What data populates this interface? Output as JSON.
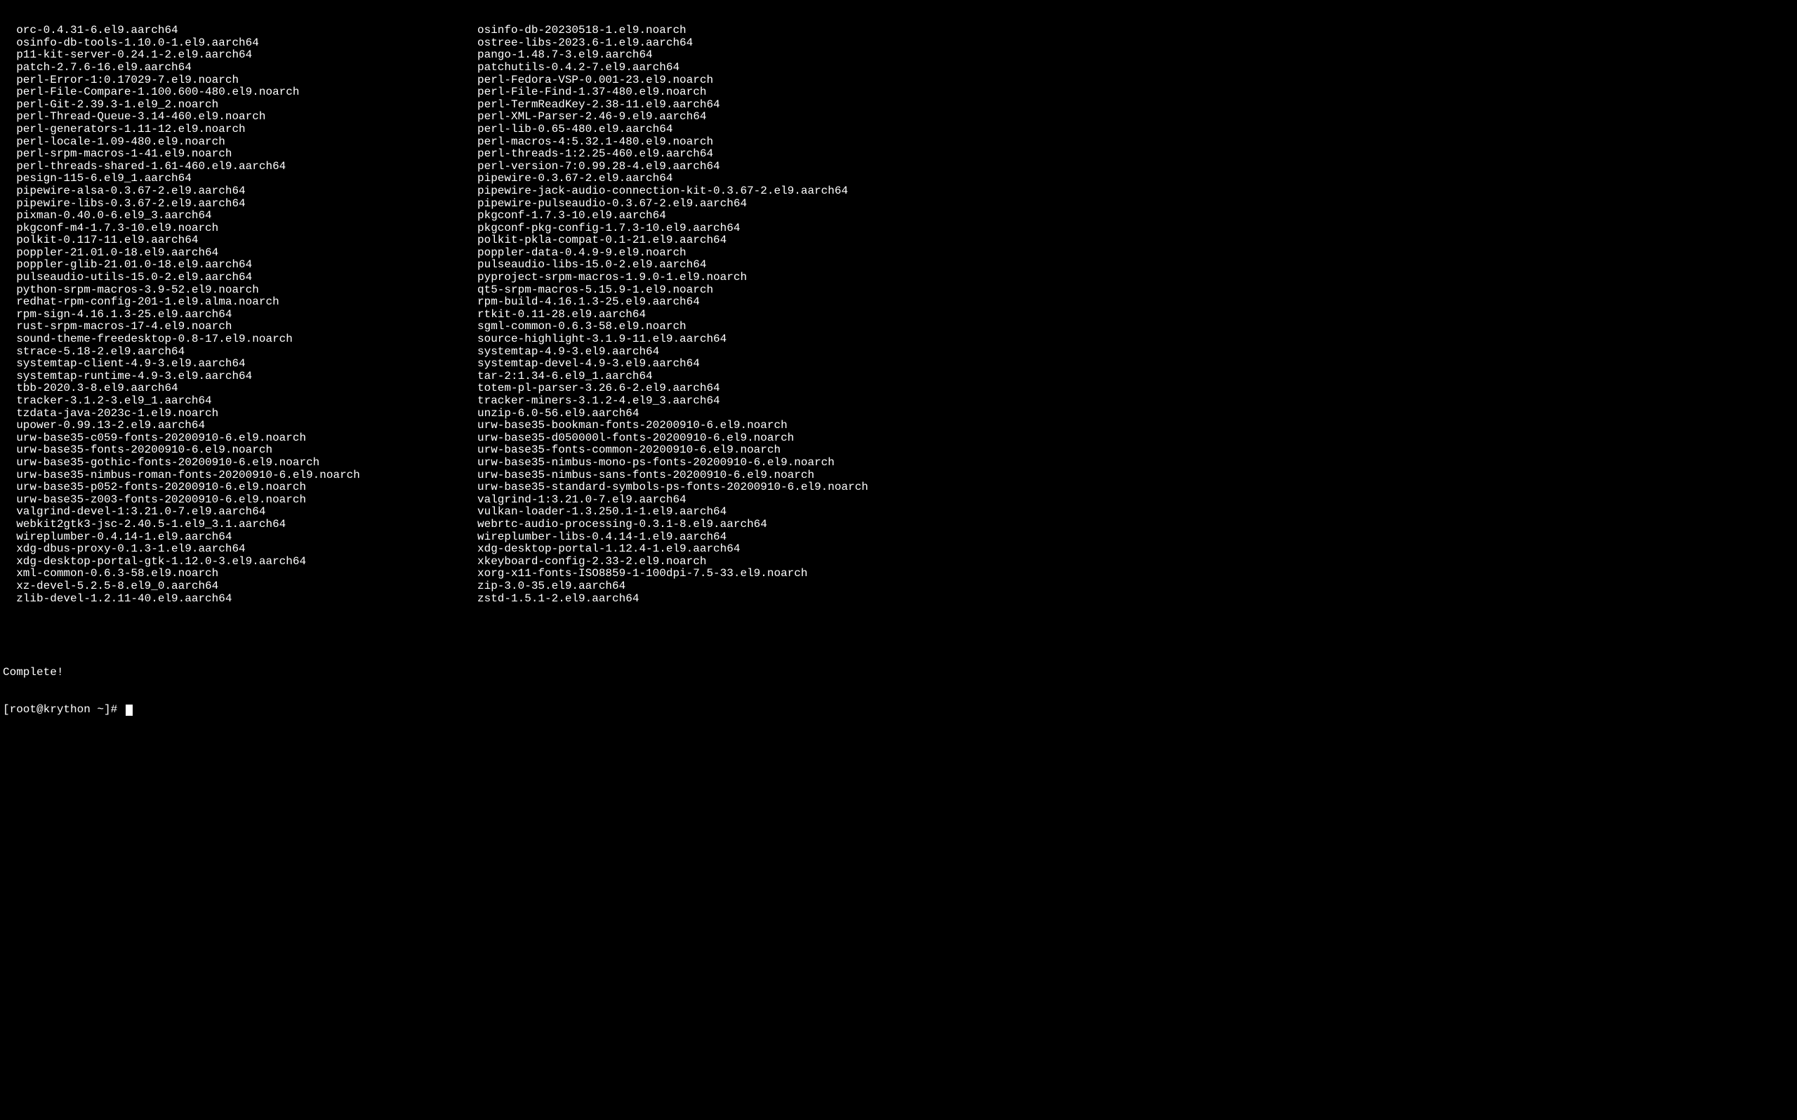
{
  "terminal": {
    "packages_left": [
      "  orc-0.4.31-6.el9.aarch64",
      "  osinfo-db-tools-1.10.0-1.el9.aarch64",
      "  p11-kit-server-0.24.1-2.el9.aarch64",
      "  patch-2.7.6-16.el9.aarch64",
      "  perl-Error-1:0.17029-7.el9.noarch",
      "  perl-File-Compare-1.100.600-480.el9.noarch",
      "  perl-Git-2.39.3-1.el9_2.noarch",
      "  perl-Thread-Queue-3.14-460.el9.noarch",
      "  perl-generators-1.11-12.el9.noarch",
      "  perl-locale-1.09-480.el9.noarch",
      "  perl-srpm-macros-1-41.el9.noarch",
      "  perl-threads-shared-1.61-460.el9.aarch64",
      "  pesign-115-6.el9_1.aarch64",
      "  pipewire-alsa-0.3.67-2.el9.aarch64",
      "  pipewire-libs-0.3.67-2.el9.aarch64",
      "  pixman-0.40.0-6.el9_3.aarch64",
      "  pkgconf-m4-1.7.3-10.el9.noarch",
      "  polkit-0.117-11.el9.aarch64",
      "  poppler-21.01.0-18.el9.aarch64",
      "  poppler-glib-21.01.0-18.el9.aarch64",
      "  pulseaudio-utils-15.0-2.el9.aarch64",
      "  python-srpm-macros-3.9-52.el9.noarch",
      "  redhat-rpm-config-201-1.el9.alma.noarch",
      "  rpm-sign-4.16.1.3-25.el9.aarch64",
      "  rust-srpm-macros-17-4.el9.noarch",
      "  sound-theme-freedesktop-0.8-17.el9.noarch",
      "  strace-5.18-2.el9.aarch64",
      "  systemtap-client-4.9-3.el9.aarch64",
      "  systemtap-runtime-4.9-3.el9.aarch64",
      "  tbb-2020.3-8.el9.aarch64",
      "  tracker-3.1.2-3.el9_1.aarch64",
      "  tzdata-java-2023c-1.el9.noarch",
      "  upower-0.99.13-2.el9.aarch64",
      "  urw-base35-c059-fonts-20200910-6.el9.noarch",
      "  urw-base35-fonts-20200910-6.el9.noarch",
      "  urw-base35-gothic-fonts-20200910-6.el9.noarch",
      "  urw-base35-nimbus-roman-fonts-20200910-6.el9.noarch",
      "  urw-base35-p052-fonts-20200910-6.el9.noarch",
      "  urw-base35-z003-fonts-20200910-6.el9.noarch",
      "  valgrind-devel-1:3.21.0-7.el9.aarch64",
      "  webkit2gtk3-jsc-2.40.5-1.el9_3.1.aarch64",
      "  wireplumber-0.4.14-1.el9.aarch64",
      "  xdg-dbus-proxy-0.1.3-1.el9.aarch64",
      "  xdg-desktop-portal-gtk-1.12.0-3.el9.aarch64",
      "  xml-common-0.6.3-58.el9.noarch",
      "  xz-devel-5.2.5-8.el9_0.aarch64",
      "  zlib-devel-1.2.11-40.el9.aarch64"
    ],
    "packages_right": [
      "osinfo-db-20230518-1.el9.noarch",
      "ostree-libs-2023.6-1.el9.aarch64",
      "pango-1.48.7-3.el9.aarch64",
      "patchutils-0.4.2-7.el9.aarch64",
      "perl-Fedora-VSP-0.001-23.el9.noarch",
      "perl-File-Find-1.37-480.el9.noarch",
      "perl-TermReadKey-2.38-11.el9.aarch64",
      "perl-XML-Parser-2.46-9.el9.aarch64",
      "perl-lib-0.65-480.el9.aarch64",
      "perl-macros-4:5.32.1-480.el9.noarch",
      "perl-threads-1:2.25-460.el9.aarch64",
      "perl-version-7:0.99.28-4.el9.aarch64",
      "pipewire-0.3.67-2.el9.aarch64",
      "pipewire-jack-audio-connection-kit-0.3.67-2.el9.aarch64",
      "pipewire-pulseaudio-0.3.67-2.el9.aarch64",
      "pkgconf-1.7.3-10.el9.aarch64",
      "pkgconf-pkg-config-1.7.3-10.el9.aarch64",
      "polkit-pkla-compat-0.1-21.el9.aarch64",
      "poppler-data-0.4.9-9.el9.noarch",
      "pulseaudio-libs-15.0-2.el9.aarch64",
      "pyproject-srpm-macros-1.9.0-1.el9.noarch",
      "qt5-srpm-macros-5.15.9-1.el9.noarch",
      "rpm-build-4.16.1.3-25.el9.aarch64",
      "rtkit-0.11-28.el9.aarch64",
      "sgml-common-0.6.3-58.el9.noarch",
      "source-highlight-3.1.9-11.el9.aarch64",
      "systemtap-4.9-3.el9.aarch64",
      "systemtap-devel-4.9-3.el9.aarch64",
      "tar-2:1.34-6.el9_1.aarch64",
      "totem-pl-parser-3.26.6-2.el9.aarch64",
      "tracker-miners-3.1.2-4.el9_3.aarch64",
      "unzip-6.0-56.el9.aarch64",
      "urw-base35-bookman-fonts-20200910-6.el9.noarch",
      "urw-base35-d050000l-fonts-20200910-6.el9.noarch",
      "urw-base35-fonts-common-20200910-6.el9.noarch",
      "urw-base35-nimbus-mono-ps-fonts-20200910-6.el9.noarch",
      "urw-base35-nimbus-sans-fonts-20200910-6.el9.noarch",
      "urw-base35-standard-symbols-ps-fonts-20200910-6.el9.noarch",
      "valgrind-1:3.21.0-7.el9.aarch64",
      "vulkan-loader-1.3.250.1-1.el9.aarch64",
      "webrtc-audio-processing-0.3.1-8.el9.aarch64",
      "wireplumber-libs-0.4.14-1.el9.aarch64",
      "xdg-desktop-portal-1.12.4-1.el9.aarch64",
      "xkeyboard-config-2.33-2.el9.noarch",
      "xorg-x11-fonts-ISO8859-1-100dpi-7.5-33.el9.noarch",
      "zip-3.0-35.el9.aarch64",
      "zstd-1.5.1-2.el9.aarch64"
    ],
    "complete_msg": "Complete!",
    "prompt": "[root@krython ~]# "
  }
}
